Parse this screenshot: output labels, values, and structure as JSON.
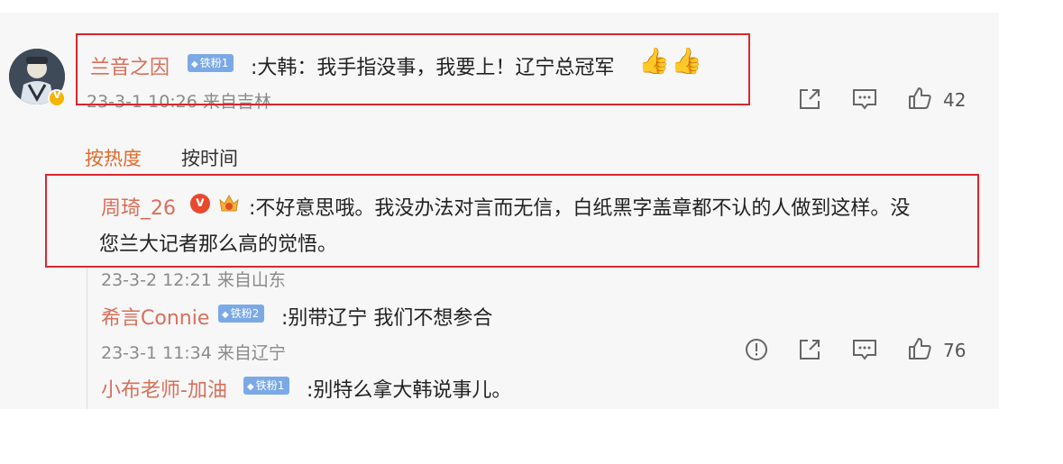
{
  "main_comment": {
    "username": "兰音之因",
    "fan_badge": "铁粉1",
    "text": ":大韩：我手指没事，我要上！辽宁总冠军",
    "emoji_icons": [
      "thumbs-up-emoji-icon",
      "thumbs-up-emoji-icon"
    ],
    "meta": "23-3-1 10:26 来自吉林",
    "like_count": "42"
  },
  "sort_tabs": {
    "hot": "按热度",
    "time": "按时间"
  },
  "replies": [
    {
      "username": "周琦_26",
      "text_line1": ":不好意思哦。我没办法对言而无信，白纸黑字盖章都不认的人做到这样。没",
      "text_line2": "您兰大记者那么高的觉悟。",
      "meta": "23-3-2 12:21 来自山东"
    },
    {
      "username": "希言Connie",
      "fan_badge": "铁粉2",
      "text": ":别带辽宁 我们不想参合",
      "meta": "23-3-1 11:34 来自辽宁",
      "like_count": "76"
    },
    {
      "username": "小布老师-加油",
      "fan_badge": "铁粉1",
      "text": ":别特么拿大韩说事儿。"
    }
  ],
  "colors": {
    "username": "#d86f5a",
    "highlight_box": "#d9272e",
    "fan_badge": "#7ba9e6",
    "sort_active": "#e06a2c"
  }
}
